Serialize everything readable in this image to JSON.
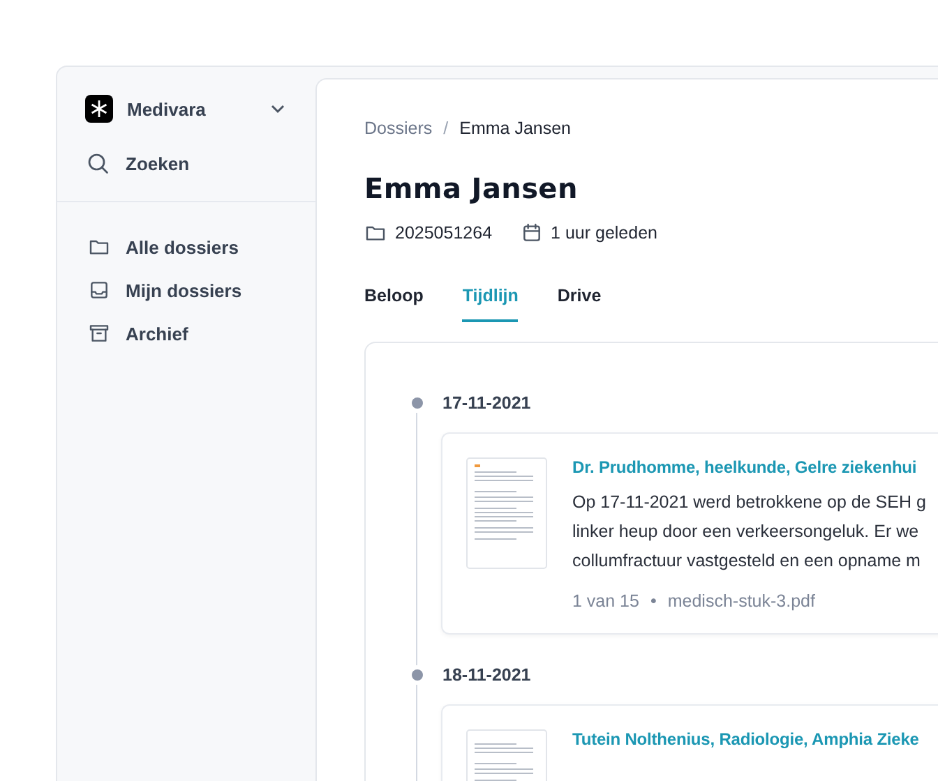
{
  "sidebar": {
    "workspace": "Medivara",
    "search_label": "Zoeken",
    "items": [
      {
        "label": "Alle dossiers"
      },
      {
        "label": "Mijn dossiers"
      },
      {
        "label": "Archief"
      }
    ]
  },
  "breadcrumb": [
    "Dossiers",
    "Emma Jansen"
  ],
  "breadcrumb_separator": "/",
  "meta_separator": "•",
  "title": "Emma Jansen",
  "meta": [
    {
      "text": "2025051264"
    },
    {
      "text": "1 uur geleden"
    }
  ],
  "tabs": [
    {
      "label": "Beloop",
      "selected": false
    },
    {
      "label": "Tijdlijn",
      "selected": true
    },
    {
      "label": "Drive",
      "selected": false
    }
  ],
  "timeline": [
    {
      "date": "17-11-2021",
      "title": "Dr. Prudhomme, heelkunde, Gelre ziekenhui",
      "body_lines": [
        "Op 17-11-2021 werd betrokkene op de SEH g",
        "linker heup door een verkeersongeluk. Er we",
        "collumfractuur vastgesteld en een opname m"
      ],
      "page": "1 van 15",
      "file": "medisch-stuk-3.pdf"
    },
    {
      "date": "18-11-2021",
      "title": "Tutein Nolthenius, Radiologie, Amphia Zieke"
    }
  ]
}
